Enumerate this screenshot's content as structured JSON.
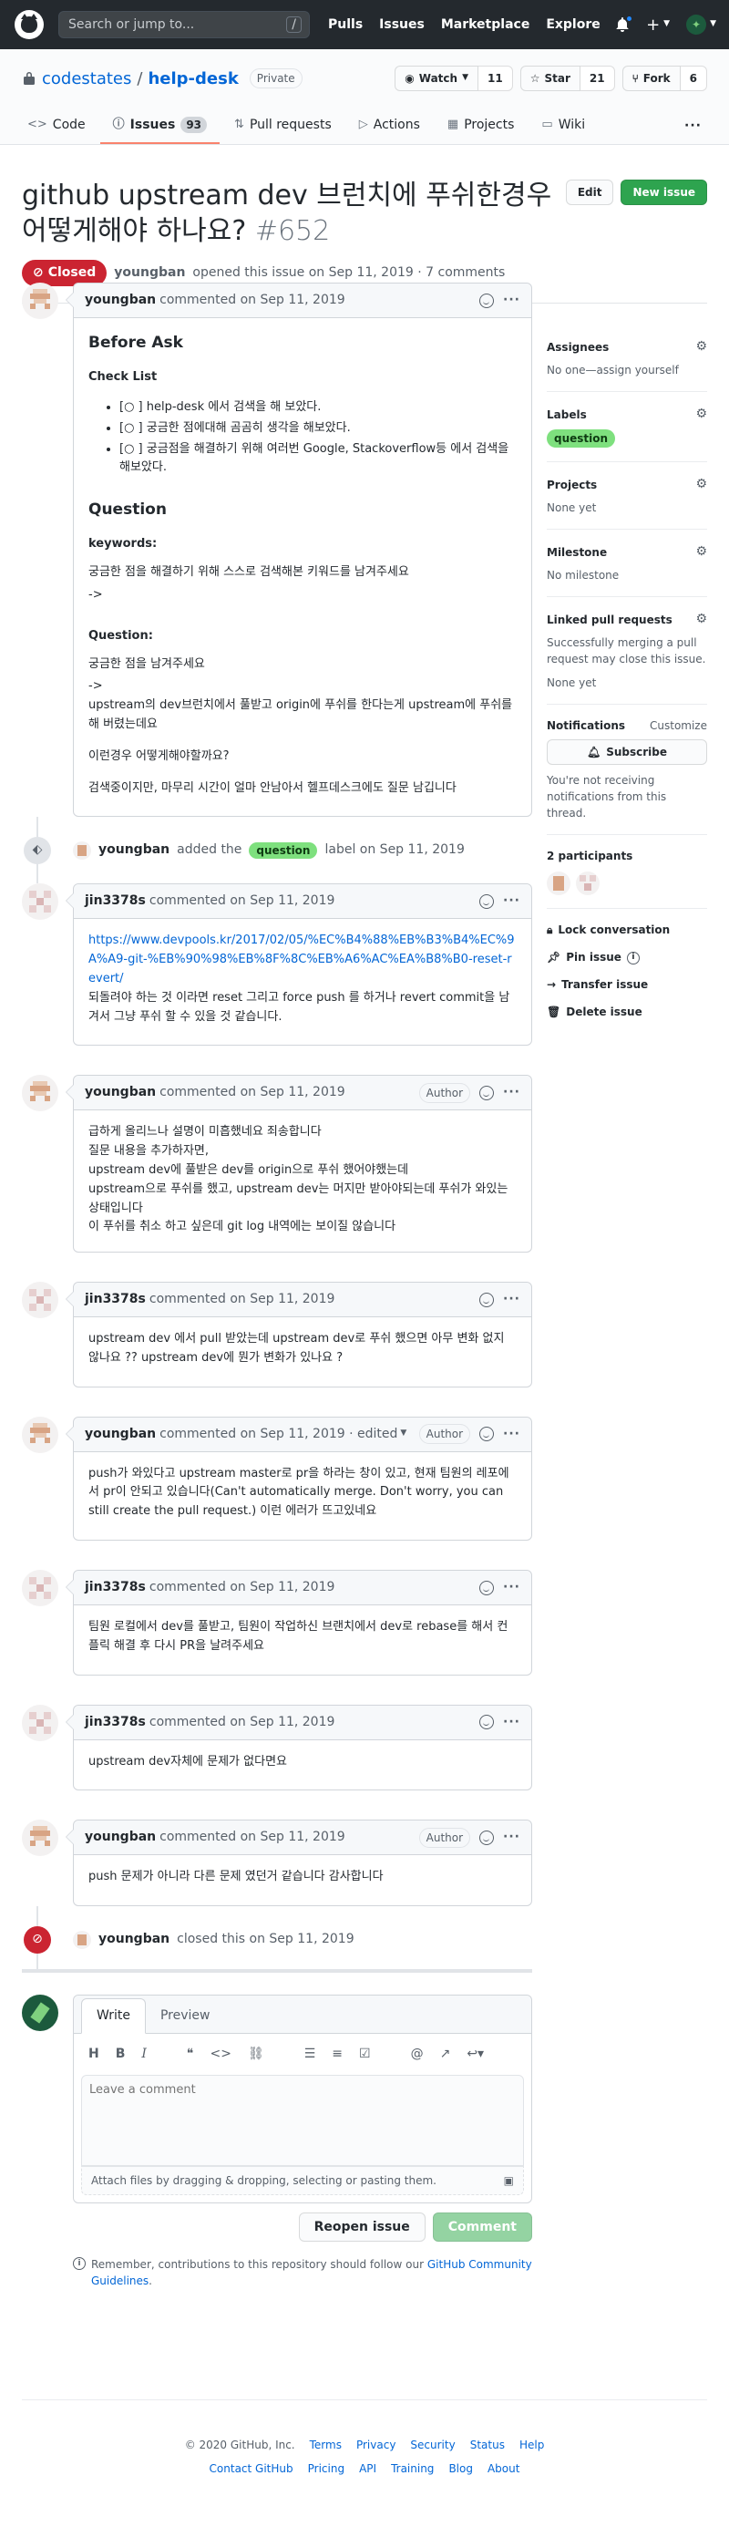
{
  "header": {
    "search_placeholder": "Search or jump to...",
    "slash": "/",
    "nav": [
      "Pulls",
      "Issues",
      "Marketplace",
      "Explore"
    ]
  },
  "repo": {
    "owner": "codestates",
    "name": "help-desk",
    "visibility": "Private",
    "watch_label": "Watch",
    "watch_count": "11",
    "star_label": "Star",
    "star_count": "21",
    "fork_label": "Fork",
    "fork_count": "6",
    "tabs": [
      {
        "label": "Code",
        "icon": "code-icon"
      },
      {
        "label": "Issues",
        "icon": "issue-icon",
        "count": "93"
      },
      {
        "label": "Pull requests",
        "icon": "pull-request-icon"
      },
      {
        "label": "Actions",
        "icon": "play-icon"
      },
      {
        "label": "Projects",
        "icon": "project-icon"
      },
      {
        "label": "Wiki",
        "icon": "book-icon"
      }
    ]
  },
  "issue": {
    "title": "github upstream dev 브런치에 푸쉬한경우 어떻게해야 하나요?",
    "number": "#652",
    "state": "Closed",
    "author": "youngban",
    "meta": "opened this issue on Sep 11, 2019 · 7 comments",
    "edit_label": "Edit",
    "new_issue_label": "New issue"
  },
  "first_comment": {
    "author": "youngban",
    "when": "commented on Sep 11, 2019",
    "h_before": "Before Ask",
    "h_checklist": "Check List",
    "checklist": [
      "[○ ] help-desk 에서 검색을 해 보았다.",
      "[○ ] 궁금한 점에대해 곰곰히 생각을 해보았다.",
      "[○ ] 궁금점을 해결하기 위해 여러번 Google, Stackoverflow등 에서 검색을 해보았다."
    ],
    "h_question": "Question",
    "h_keywords": "keywords:",
    "keywords_text": "궁금한 점을 해결하기 위해 스스로 검색해본 키워드를 남겨주세요",
    "arrow1": "->",
    "h_question2": "Question:",
    "question_text": "궁금한 점을 남겨주세요",
    "arrow2": "->",
    "question_body": "upstream의 dev브런치에서 풀받고 origin에 푸쉬를 한다는게 upstream에 푸쉬를 해 버렸는데요",
    "question_q": "이런경우 어떻게해야할까요?",
    "question_end": "검색중이지만, 마무리 시간이 얼마 안남아서 헬프데스크에도 질문 남깁니다"
  },
  "label_event": {
    "actor": "youngban",
    "pre": "added the",
    "label": "question",
    "post": "label on Sep 11, 2019"
  },
  "comments": [
    {
      "author": "jin3378s",
      "when": "commented on Sep 11, 2019",
      "link": "https://www.devpools.kr/2017/02/05/%EC%B4%88%EB%B3%B4%EC%9A%A9-git-%EB%90%98%EB%8F%8C%EB%A6%AC%EA%B8%B0-reset-revert/",
      "text": "되돌려야 하는 것 이라면 reset 그리고 force push 를 하거나 revert commit을 남겨서 그냥 푸쉬 할 수 있을 것 같습니다."
    },
    {
      "author": "youngban",
      "when": "commented on Sep 11, 2019",
      "badge": "Author",
      "lines": [
        "급하게 올리느나 설명이 미흡했네요 죄송합니다",
        "질문 내용을 추가하자면,",
        "upstream dev에 풀받은 dev를 origin으로 푸쉬 했어야했는데",
        "upstream으로 푸쉬를 했고, upstream dev는 머지만 받아야되는데 푸쉬가 와있는 상태입니다",
        "이 푸쉬를 취소 하고 싶은데 git log 내역에는 보이질 않습니다"
      ]
    },
    {
      "author": "jin3378s",
      "when": "commented on Sep 11, 2019",
      "text": "upstream dev 에서 pull 받았는데 upstream dev로 푸쉬 했으면 아무 변화 없지 않나요 ?? upstream dev에 뭔가 변화가 있나요 ?"
    },
    {
      "author": "youngban",
      "when": "commented on Sep 11, 2019 · edited",
      "badge": "Author",
      "text": "push가 와있다고 upstream master로 pr을 하라는 창이 있고, 현재 팀원의 레포에서 pr이 안되고 있습니다(Can't automatically merge. Don't worry, you can still create the pull request.) 이런 에러가 뜨고있네요"
    },
    {
      "author": "jin3378s",
      "when": "commented on Sep 11, 2019",
      "text": "팀원 로컬에서 dev를 풀받고, 팀원이 작업하신 브랜치에서 dev로 rebase를 해서 컨플릭 해결 후 다시 PR을 날려주세요"
    },
    {
      "author": "jin3378s",
      "when": "commented on Sep 11, 2019",
      "text": "upstream dev자체에 문제가 없다면요"
    },
    {
      "author": "youngban",
      "when": "commented on Sep 11, 2019",
      "badge": "Author",
      "text": "push 문제가 아니라 다른 문제 였던거 같습니다 감사합니다"
    }
  ],
  "close_event": {
    "actor": "youngban",
    "text": "closed this on Sep 11, 2019"
  },
  "new_comment": {
    "tab_write": "Write",
    "tab_preview": "Preview",
    "placeholder": "Leave a comment",
    "attach": "Attach files by dragging & dropping, selecting or pasting them.",
    "reopen": "Reopen issue",
    "submit": "Comment",
    "note_pre": "Remember, contributions to this repository should follow our",
    "note_link": "GitHub Community Guidelines",
    "note_post": "."
  },
  "sidebar": {
    "assignees_h": "Assignees",
    "assignees_v": "No one—assign yourself",
    "labels_h": "Labels",
    "label": "question",
    "projects_h": "Projects",
    "projects_v": "None yet",
    "milestone_h": "Milestone",
    "milestone_v": "No milestone",
    "linked_h": "Linked pull requests",
    "linked_desc": "Successfully merging a pull request may close this issue.",
    "linked_v": "None yet",
    "notif_h": "Notifications",
    "customize": "Customize",
    "subscribe": "Subscribe",
    "notif_desc": "You're not receiving notifications from this thread.",
    "participants": "2 participants",
    "lock": "Lock conversation",
    "pin": "Pin issue",
    "transfer": "Transfer issue",
    "delete": "Delete issue"
  },
  "footer": {
    "copy": "© 2020 GitHub, Inc.",
    "row1": [
      "Terms",
      "Privacy",
      "Security",
      "Status",
      "Help"
    ],
    "row2": [
      "Contact GitHub",
      "Pricing",
      "API",
      "Training",
      "Blog",
      "About"
    ]
  },
  "colors": {
    "closed": "#cb2431",
    "label": "#7ee07e",
    "green": "#2ea44f",
    "link": "#0366d6"
  }
}
